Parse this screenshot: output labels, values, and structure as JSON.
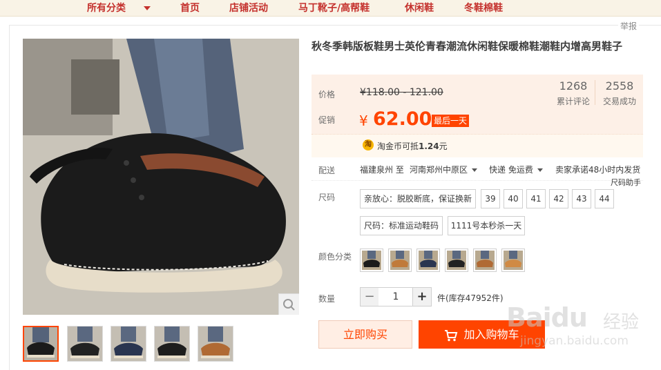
{
  "nav": {
    "items": [
      "所有分类",
      "首页",
      "店铺活动",
      "马丁靴子/高帮鞋",
      "休闲鞋",
      "冬鞋棉鞋"
    ]
  },
  "report_label": "举报",
  "product": {
    "title": "秋冬季韩版板鞋男士英伦青春潮流休闲鞋保暖棉鞋潮鞋内增高男鞋子"
  },
  "price": {
    "label": "价格",
    "original": "¥118.00 - 121.00",
    "promo_label": "促销",
    "currency": "¥",
    "current": "62.00",
    "tag": "最后一天"
  },
  "stats": [
    {
      "value": "1268",
      "label": "累计评论"
    },
    {
      "value": "2558",
      "label": "交易成功"
    }
  ],
  "coin": {
    "icon": "淘",
    "text_prefix": "淘金币可抵",
    "amount": "1.24",
    "unit": "元"
  },
  "shipping": {
    "label": "配送",
    "origin": "福建泉州 至",
    "destination": "河南郑州中原区",
    "method": "快递 免运费",
    "promise": "卖家承诺48小时内发货"
  },
  "size": {
    "label": "尺码",
    "helper": "尺码助手",
    "options_row1": [
      "亲放心：脱胶断底，保证换新",
      "39",
      "40",
      "41",
      "42",
      "43",
      "44"
    ],
    "options_row2": [
      "尺码：标准运动鞋码",
      "1111号本秒杀一天"
    ]
  },
  "color": {
    "label": "颜色分类",
    "swatch_count": 6
  },
  "quantity": {
    "label": "数量",
    "minus": "−",
    "value": "1",
    "plus": "+",
    "stock": "件(库存47952件)"
  },
  "actions": {
    "buy": "立即购买",
    "cart": "加入购物车"
  },
  "watermark": {
    "brand": "Baidu",
    "cn": "经验",
    "url": "jingyan.baidu.com"
  },
  "colors": {
    "accent": "#ff4400",
    "nav_text": "#c4302c",
    "price_bg": "#fdf0e7"
  }
}
